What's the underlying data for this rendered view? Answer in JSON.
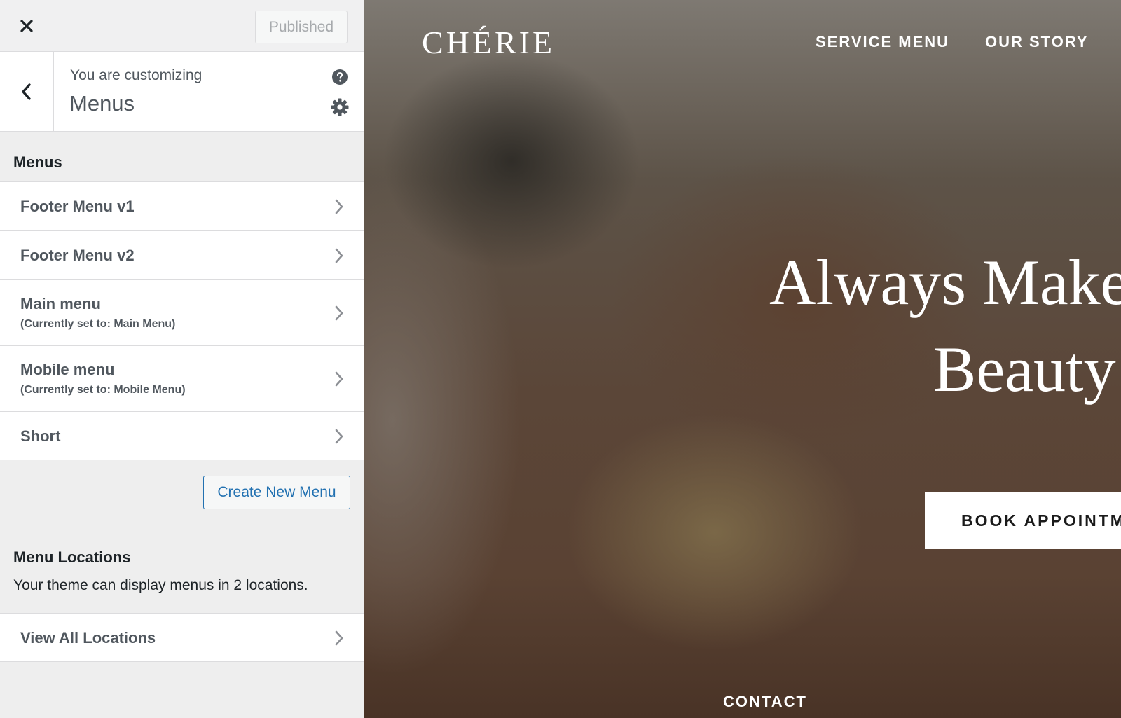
{
  "customizer": {
    "publish_label": "Published",
    "customizing_label": "You are customizing",
    "panel_title": "Menus",
    "menus_heading": "Menus",
    "menus": [
      {
        "title": "Footer Menu v1",
        "subtitle": ""
      },
      {
        "title": "Footer Menu v2",
        "subtitle": ""
      },
      {
        "title": "Main menu",
        "subtitle": "(Currently set to: Main Menu)"
      },
      {
        "title": "Mobile menu",
        "subtitle": "(Currently set to: Mobile Menu)"
      },
      {
        "title": "Short",
        "subtitle": ""
      }
    ],
    "create_menu_label": "Create New Menu",
    "locations_heading": "Menu Locations",
    "locations_desc": "Your theme can display menus in 2 locations.",
    "view_locations_label": "View All Locations",
    "icons": [
      "close-icon",
      "back-chevron-icon",
      "help-icon",
      "gear-icon",
      "chevron-right-icon"
    ],
    "colors": {
      "accent": "#2271b1",
      "text": "#50575e",
      "panel_bg": "#eeeeee"
    }
  },
  "preview": {
    "brand": "CHÉRIE",
    "nav": [
      "SERVICE MENU",
      "OUR STORY"
    ],
    "hero_line1": "Always Make",
    "hero_line2": "Beauty",
    "cta_label": "BOOK APPOINTME",
    "footer_link": "CONTACT"
  }
}
